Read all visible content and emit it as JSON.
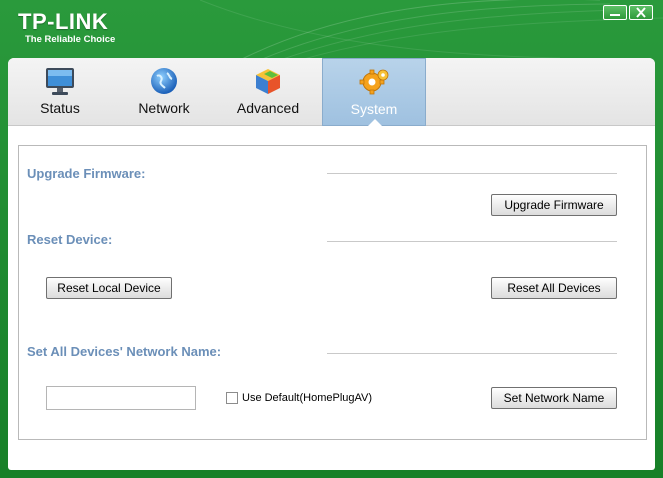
{
  "app": {
    "brand": "TP-LINK",
    "tagline": "The Reliable Choice",
    "colors": {
      "frame": "#1f8a30",
      "accent": "#6b8fb8",
      "active_tab": "#a9c8e4"
    }
  },
  "window_controls": {
    "minimize_icon": "minimize-icon",
    "close_icon": "close-icon"
  },
  "tabs": [
    {
      "label": "Status",
      "icon": "monitor-icon",
      "active": false
    },
    {
      "label": "Network",
      "icon": "globe-icon",
      "active": false
    },
    {
      "label": "Advanced",
      "icon": "cube-icon",
      "active": false
    },
    {
      "label": "System",
      "icon": "gears-icon",
      "active": true
    }
  ],
  "system": {
    "upgrade": {
      "title": "Upgrade Firmware:",
      "button": "Upgrade Firmware"
    },
    "reset": {
      "title": "Reset Device:",
      "local_button": "Reset Local Device",
      "all_button": "Reset All Devices"
    },
    "network_name": {
      "title": "Set All Devices' Network Name:",
      "input_value": "",
      "checkbox_label": "Use Default(HomePlugAV)",
      "checkbox_checked": false,
      "button": "Set Network Name"
    }
  }
}
